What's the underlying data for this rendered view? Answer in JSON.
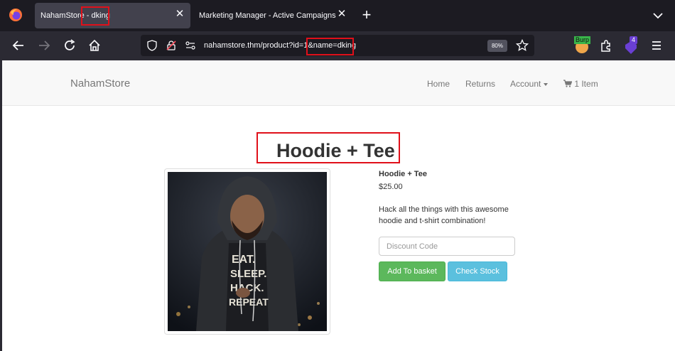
{
  "browser": {
    "tabs": [
      {
        "title": "NahamStore - dking",
        "active": true
      },
      {
        "title": "Marketing Manager - Active Campaigns",
        "active": false
      }
    ],
    "url": "nahamstore.thm/product?id=1&name=dking",
    "zoom": "80%",
    "extension_badge_burp": "Burp",
    "extension_badge_count": "4"
  },
  "site": {
    "brand": "NahamStore",
    "nav": {
      "home": "Home",
      "returns": "Returns",
      "account": "Account",
      "basket": "1 Item"
    }
  },
  "product": {
    "heading": "Hoodie + Tee",
    "name": "Hoodie + Tee",
    "price": "$25.00",
    "description": "Hack all the things with this awesome hoodie and t-shirt combination!",
    "shirt_text": [
      "EAT.",
      "SLEEP.",
      "HACK.",
      "REPEAT"
    ],
    "discount_placeholder": "Discount Code",
    "add_to_basket_label": "Add To basket",
    "check_stock_label": "Check Stock"
  },
  "colors": {
    "annotation_highlight": "#e0101a",
    "btn_success": "#5cb85c",
    "btn_info": "#5bc0de"
  }
}
